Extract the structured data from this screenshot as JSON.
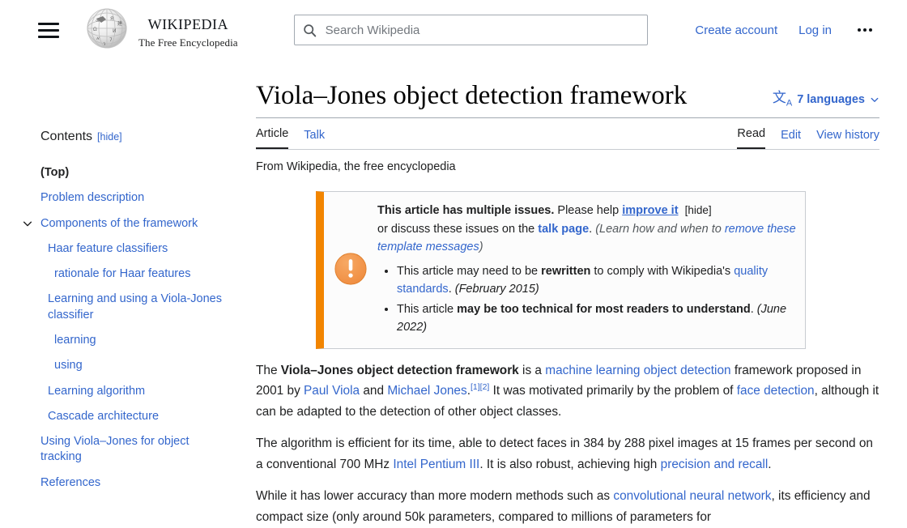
{
  "header": {
    "menu_icon": "hamburger-icon",
    "logo_wordmark_main": "Wikipedia",
    "logo_wordmark_sub": "The Free Encyclopedia",
    "search": {
      "icon": "search-icon",
      "placeholder": "Search Wikipedia",
      "value": ""
    },
    "create_account": "Create account",
    "log_in": "Log in",
    "more_icon": "ellipsis-icon"
  },
  "toc": {
    "title": "Contents",
    "hide_label": "[hide]",
    "items": [
      {
        "label": "(Top)",
        "level": 1,
        "active": true
      },
      {
        "label": "Problem description",
        "level": 1
      },
      {
        "label": "Components of the framework",
        "level": 1,
        "expandable": true,
        "expanded": true
      },
      {
        "label": "Haar feature classifiers",
        "level": 2
      },
      {
        "label": "rationale for Haar features",
        "level": 3
      },
      {
        "label": "Learning and using a Viola-Jones classifier",
        "level": 2
      },
      {
        "label": "learning",
        "level": 3
      },
      {
        "label": "using",
        "level": 3
      },
      {
        "label": "Learning algorithm",
        "level": 2
      },
      {
        "label": "Cascade architecture",
        "level": 2
      },
      {
        "label": "Using Viola–Jones for object tracking",
        "level": 1
      },
      {
        "label": "References",
        "level": 1
      }
    ]
  },
  "article": {
    "title": "Viola–Jones object detection framework",
    "languages_label": "7 languages",
    "languages_icon": "文",
    "languages_icon_sub": "A",
    "tabs_left": [
      {
        "label": "Article",
        "active": true
      },
      {
        "label": "Talk",
        "active": false
      }
    ],
    "tabs_right": [
      {
        "label": "Read",
        "active": true
      },
      {
        "label": "Edit",
        "active": false
      },
      {
        "label": "View history",
        "active": false
      }
    ],
    "from_line": "From Wikipedia, the free encyclopedia"
  },
  "issue_banner": {
    "icon": "exclamation-circle-icon",
    "accent_color": "#f28500",
    "head_1": "This article has multiple issues.",
    "head_2": " Please help ",
    "improve_link": "improve it",
    "hide_label": "[hide]",
    "head_3": "or discuss these issues on the ",
    "talk_link": "talk page",
    "head_4": ". ",
    "learn_text_1": "(Learn how and when to",
    "learn_link": "remove these template messages",
    "learn_text_2": ")",
    "issues": [
      {
        "text_1": "This article may need to be ",
        "bold_1": "rewritten",
        "text_2": " to comply with Wikipedia's ",
        "link_1": "quality standards",
        "text_3": ". ",
        "date": "(February 2015)"
      },
      {
        "text_1": "This article ",
        "bold_1": "may be too technical for most readers to understand",
        "text_2": ". ",
        "link_1": "",
        "text_3": "",
        "date": "(June 2022)"
      }
    ]
  },
  "paragraphs": [
    {
      "id": "lead",
      "parts": [
        {
          "t": "text",
          "v": "The "
        },
        {
          "t": "bold",
          "v": "Viola–Jones object detection framework"
        },
        {
          "t": "text",
          "v": " is a "
        },
        {
          "t": "link",
          "v": "machine learning object detection"
        },
        {
          "t": "text",
          "v": " framework proposed in 2001 by "
        },
        {
          "t": "link",
          "v": "Paul Viola"
        },
        {
          "t": "text",
          "v": " and "
        },
        {
          "t": "link",
          "v": "Michael Jones"
        },
        {
          "t": "text",
          "v": "."
        },
        {
          "t": "ref",
          "v": "[1]"
        },
        {
          "t": "ref",
          "v": "[2]"
        },
        {
          "t": "text",
          "v": " It was motivated primarily by the problem of "
        },
        {
          "t": "link",
          "v": "face detection"
        },
        {
          "t": "text",
          "v": ", although it can be adapted to the detection of other object classes."
        }
      ]
    },
    {
      "id": "efficiency",
      "parts": [
        {
          "t": "text",
          "v": "The algorithm is efficient for its time, able to detect faces in 384 by 288 pixel images at 15 frames per second on a conventional 700 MHz "
        },
        {
          "t": "link",
          "v": "Intel Pentium III"
        },
        {
          "t": "text",
          "v": ". It is also robust, achieving high "
        },
        {
          "t": "link",
          "v": "precision and recall"
        },
        {
          "t": "text",
          "v": "."
        }
      ]
    },
    {
      "id": "accuracy",
      "parts": [
        {
          "t": "text",
          "v": "While it has lower accuracy than more modern methods such as "
        },
        {
          "t": "link",
          "v": "convolutional neural network"
        },
        {
          "t": "text",
          "v": ", its efficiency and compact size (only around 50k parameters, compared to millions of parameters for"
        }
      ]
    }
  ],
  "colors": {
    "link": "#3366cc",
    "text": "#202122",
    "border": "#a2a9b1",
    "banner_accent": "#f28500"
  }
}
